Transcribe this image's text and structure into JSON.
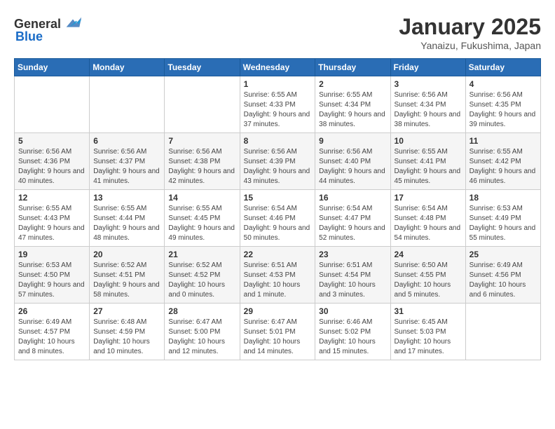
{
  "app": {
    "logo_general": "General",
    "logo_blue": "Blue"
  },
  "header": {
    "title": "January 2025",
    "subtitle": "Yanaizu, Fukushima, Japan"
  },
  "weekdays": [
    "Sunday",
    "Monday",
    "Tuesday",
    "Wednesday",
    "Thursday",
    "Friday",
    "Saturday"
  ],
  "weeks": [
    [
      {
        "day": "",
        "info": ""
      },
      {
        "day": "",
        "info": ""
      },
      {
        "day": "",
        "info": ""
      },
      {
        "day": "1",
        "info": "Sunrise: 6:55 AM\nSunset: 4:33 PM\nDaylight: 9 hours and 37 minutes."
      },
      {
        "day": "2",
        "info": "Sunrise: 6:55 AM\nSunset: 4:34 PM\nDaylight: 9 hours and 38 minutes."
      },
      {
        "day": "3",
        "info": "Sunrise: 6:56 AM\nSunset: 4:34 PM\nDaylight: 9 hours and 38 minutes."
      },
      {
        "day": "4",
        "info": "Sunrise: 6:56 AM\nSunset: 4:35 PM\nDaylight: 9 hours and 39 minutes."
      }
    ],
    [
      {
        "day": "5",
        "info": "Sunrise: 6:56 AM\nSunset: 4:36 PM\nDaylight: 9 hours and 40 minutes."
      },
      {
        "day": "6",
        "info": "Sunrise: 6:56 AM\nSunset: 4:37 PM\nDaylight: 9 hours and 41 minutes."
      },
      {
        "day": "7",
        "info": "Sunrise: 6:56 AM\nSunset: 4:38 PM\nDaylight: 9 hours and 42 minutes."
      },
      {
        "day": "8",
        "info": "Sunrise: 6:56 AM\nSunset: 4:39 PM\nDaylight: 9 hours and 43 minutes."
      },
      {
        "day": "9",
        "info": "Sunrise: 6:56 AM\nSunset: 4:40 PM\nDaylight: 9 hours and 44 minutes."
      },
      {
        "day": "10",
        "info": "Sunrise: 6:55 AM\nSunset: 4:41 PM\nDaylight: 9 hours and 45 minutes."
      },
      {
        "day": "11",
        "info": "Sunrise: 6:55 AM\nSunset: 4:42 PM\nDaylight: 9 hours and 46 minutes."
      }
    ],
    [
      {
        "day": "12",
        "info": "Sunrise: 6:55 AM\nSunset: 4:43 PM\nDaylight: 9 hours and 47 minutes."
      },
      {
        "day": "13",
        "info": "Sunrise: 6:55 AM\nSunset: 4:44 PM\nDaylight: 9 hours and 48 minutes."
      },
      {
        "day": "14",
        "info": "Sunrise: 6:55 AM\nSunset: 4:45 PM\nDaylight: 9 hours and 49 minutes."
      },
      {
        "day": "15",
        "info": "Sunrise: 6:54 AM\nSunset: 4:46 PM\nDaylight: 9 hours and 50 minutes."
      },
      {
        "day": "16",
        "info": "Sunrise: 6:54 AM\nSunset: 4:47 PM\nDaylight: 9 hours and 52 minutes."
      },
      {
        "day": "17",
        "info": "Sunrise: 6:54 AM\nSunset: 4:48 PM\nDaylight: 9 hours and 54 minutes."
      },
      {
        "day": "18",
        "info": "Sunrise: 6:53 AM\nSunset: 4:49 PM\nDaylight: 9 hours and 55 minutes."
      }
    ],
    [
      {
        "day": "19",
        "info": "Sunrise: 6:53 AM\nSunset: 4:50 PM\nDaylight: 9 hours and 57 minutes."
      },
      {
        "day": "20",
        "info": "Sunrise: 6:52 AM\nSunset: 4:51 PM\nDaylight: 9 hours and 58 minutes."
      },
      {
        "day": "21",
        "info": "Sunrise: 6:52 AM\nSunset: 4:52 PM\nDaylight: 10 hours and 0 minutes."
      },
      {
        "day": "22",
        "info": "Sunrise: 6:51 AM\nSunset: 4:53 PM\nDaylight: 10 hours and 1 minute."
      },
      {
        "day": "23",
        "info": "Sunrise: 6:51 AM\nSunset: 4:54 PM\nDaylight: 10 hours and 3 minutes."
      },
      {
        "day": "24",
        "info": "Sunrise: 6:50 AM\nSunset: 4:55 PM\nDaylight: 10 hours and 5 minutes."
      },
      {
        "day": "25",
        "info": "Sunrise: 6:49 AM\nSunset: 4:56 PM\nDaylight: 10 hours and 6 minutes."
      }
    ],
    [
      {
        "day": "26",
        "info": "Sunrise: 6:49 AM\nSunset: 4:57 PM\nDaylight: 10 hours and 8 minutes."
      },
      {
        "day": "27",
        "info": "Sunrise: 6:48 AM\nSunset: 4:59 PM\nDaylight: 10 hours and 10 minutes."
      },
      {
        "day": "28",
        "info": "Sunrise: 6:47 AM\nSunset: 5:00 PM\nDaylight: 10 hours and 12 minutes."
      },
      {
        "day": "29",
        "info": "Sunrise: 6:47 AM\nSunset: 5:01 PM\nDaylight: 10 hours and 14 minutes."
      },
      {
        "day": "30",
        "info": "Sunrise: 6:46 AM\nSunset: 5:02 PM\nDaylight: 10 hours and 15 minutes."
      },
      {
        "day": "31",
        "info": "Sunrise: 6:45 AM\nSunset: 5:03 PM\nDaylight: 10 hours and 17 minutes."
      },
      {
        "day": "",
        "info": ""
      }
    ]
  ]
}
